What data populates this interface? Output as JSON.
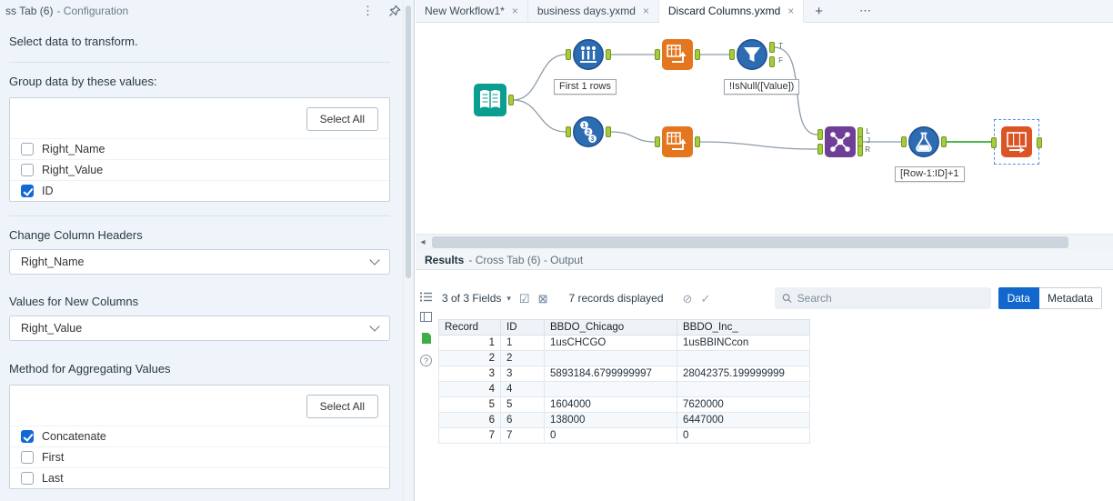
{
  "colors": {
    "accent_blue": "#1167cb",
    "anchor_green": "#a6cc3d",
    "tool_teal": "#0a9e90",
    "tool_blue": "#2d6cb3",
    "tool_orange": "#e4761f",
    "tool_purple": "#6f3e97",
    "tool_red_orange": "#da5426",
    "highlight_wire_green": "#2eae2e"
  },
  "config": {
    "title": "ss Tab (6)",
    "title_suffix": "- Configuration",
    "subtitle": "Select data to transform.",
    "group_by": {
      "label": "Group data by these values:",
      "select_all": "Select All",
      "items": [
        {
          "label": "Right_Name",
          "checked": false
        },
        {
          "label": "Right_Value",
          "checked": false
        },
        {
          "label": "ID",
          "checked": true
        }
      ]
    },
    "column_headers": {
      "label": "Change Column Headers",
      "value": "Right_Name"
    },
    "new_columns": {
      "label": "Values for New Columns",
      "value": "Right_Value"
    },
    "aggregation": {
      "label": "Method for Aggregating Values",
      "select_all": "Select All",
      "items": [
        {
          "label": "Concatenate",
          "checked": true
        },
        {
          "label": "First",
          "checked": false
        },
        {
          "label": "Last",
          "checked": false
        }
      ]
    }
  },
  "tabs": {
    "items": [
      {
        "label": "New Workflow1*",
        "active": false
      },
      {
        "label": "business days.yxmd",
        "active": false
      },
      {
        "label": "Discard Columns.yxmd",
        "active": true
      }
    ],
    "add_label": "+",
    "more_label": "⋯"
  },
  "canvas": {
    "annotation_sample": "First 1 rows",
    "annotation_filter": "!IsNull([Value])",
    "annotation_multirow": "[Row-1:ID]+1",
    "anchor_letters": {
      "t": "T",
      "f": "F",
      "l": "L",
      "j": "J",
      "r": "R"
    }
  },
  "results": {
    "title": "Results",
    "title_suffix": "- Cross Tab (6) - Output",
    "fields_selector": "3 of 3 Fields",
    "records_text": "7 records displayed",
    "search_placeholder": "Search",
    "data_tab": "Data",
    "metadata_tab": "Metadata",
    "columns": [
      "Record",
      "ID",
      "BBDO_Chicago",
      "BBDO_Inc_"
    ],
    "rows": [
      [
        "1",
        "1",
        "1usCHCGO",
        "1usBBINCcon"
      ],
      [
        "2",
        "2",
        "",
        ""
      ],
      [
        "3",
        "3",
        "5893184.6799999997",
        "28042375.199999999"
      ],
      [
        "4",
        "4",
        "",
        ""
      ],
      [
        "5",
        "5",
        "1604000",
        "7620000"
      ],
      [
        "6",
        "6",
        "138000",
        "6447000"
      ],
      [
        "7",
        "7",
        "0",
        "0"
      ]
    ]
  }
}
